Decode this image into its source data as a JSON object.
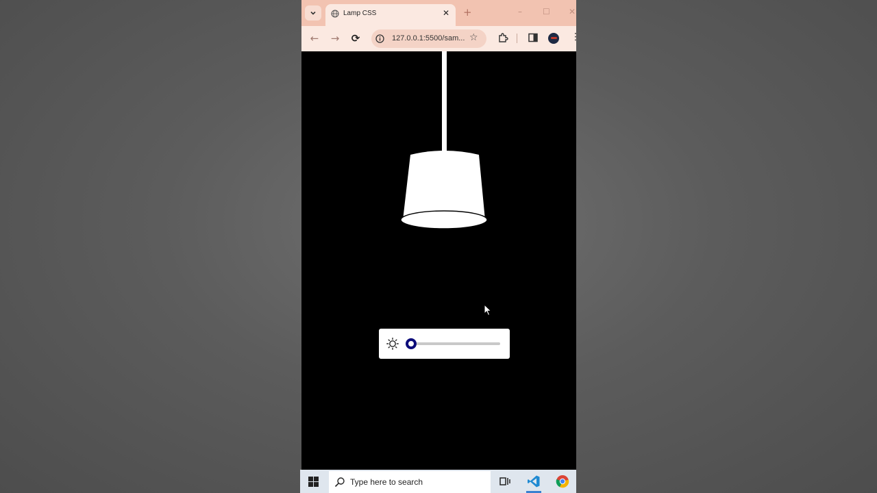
{
  "browser": {
    "tab": {
      "title": "Lamp CSS",
      "favicon": "globe-icon",
      "close_glyph": "✕"
    },
    "new_tab_glyph": "+",
    "window_controls": {
      "minimize": "–",
      "maximize": "☐",
      "close": "✕"
    },
    "toolbar": {
      "back_glyph": "←",
      "forward_glyph": "→",
      "reload_glyph": "⟳",
      "url": "127.0.0.1:5500/sam...",
      "bookmark_glyph": "☆",
      "menu_glyph": "⋮",
      "icons": [
        "info-icon",
        "extensions-icon",
        "side-panel-icon",
        "profile-avatar"
      ]
    },
    "theme_color": "#f2c3b1"
  },
  "page": {
    "background": "#000000",
    "lamp": {
      "color": "#ffffff"
    },
    "brightness_control": {
      "icon": "sun-icon",
      "value_fraction": 0.0,
      "thumb_color": "#0c0c7a"
    }
  },
  "taskbar": {
    "search_placeholder": "Type here to search",
    "apps": [
      "start-button",
      "task-view-icon",
      "vscode-icon",
      "chrome-icon"
    ],
    "accent_color": "#3a80d0"
  }
}
